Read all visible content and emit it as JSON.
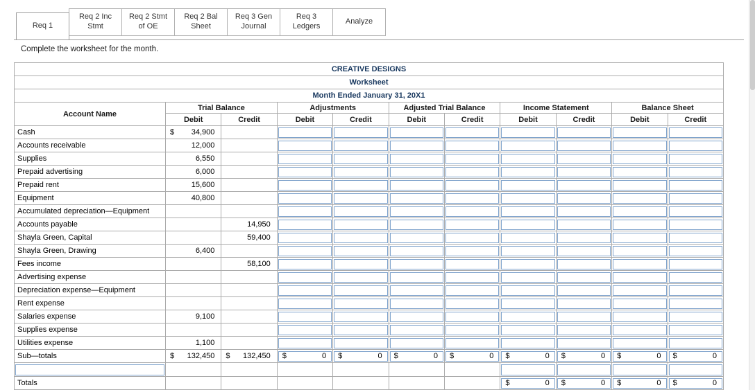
{
  "colors": {
    "title_navy": "#17375e",
    "input_border": "#7fa3cc",
    "grid_border": "#ababab",
    "tab_border": "#b0b0b0"
  },
  "tabs": [
    {
      "label": "Req 1",
      "active": true
    },
    {
      "label": "Req 2 Inc Stmt",
      "active": false
    },
    {
      "label": "Req 2 Stmt of OE",
      "active": false
    },
    {
      "label": "Req 2 Bal Sheet",
      "active": false
    },
    {
      "label": "Req 3 Gen Journal",
      "active": false
    },
    {
      "label": "Req 3 Ledgers",
      "active": false
    },
    {
      "label": "Analyze",
      "active": false
    }
  ],
  "instruction": "Complete the worksheet for the month.",
  "worksheet": {
    "company": "CREATIVE DESIGNS",
    "title": "Worksheet",
    "period": "Month Ended January 31, 20X1",
    "account_header": "Account Name",
    "column_groups": [
      "Trial Balance",
      "Adjustments",
      "Adjusted Trial Balance",
      "Income Statement",
      "Balance Sheet"
    ],
    "sub_headers": [
      "Debit",
      "Credit"
    ],
    "currency": "$",
    "column_keys": [
      "tb_debit",
      "tb_credit",
      "adj_debit",
      "adj_credit",
      "atb_debit",
      "atb_credit",
      "is_debit",
      "is_credit",
      "bs_debit",
      "bs_credit"
    ],
    "body": {
      "account_row_inputs": [
        "adj_debit",
        "adj_credit",
        "atb_debit",
        "atb_credit",
        "is_debit",
        "is_credit",
        "bs_debit",
        "bs_credit"
      ],
      "account_rows": [
        {
          "account": "Cash",
          "values": {
            "tb_debit": "34,900"
          },
          "dollars": [
            "tb_debit"
          ]
        },
        {
          "account": "Accounts receivable",
          "values": {
            "tb_debit": "12,000"
          }
        },
        {
          "account": "Supplies",
          "values": {
            "tb_debit": "6,550"
          }
        },
        {
          "account": "Prepaid advertising",
          "values": {
            "tb_debit": "6,000"
          }
        },
        {
          "account": "Prepaid rent",
          "values": {
            "tb_debit": "15,600"
          }
        },
        {
          "account": "Equipment",
          "values": {
            "tb_debit": "40,800"
          }
        },
        {
          "account": "Accumulated depreciation—Equipment",
          "values": {}
        },
        {
          "account": "Accounts payable",
          "values": {
            "tb_credit": "14,950"
          }
        },
        {
          "account": "Shayla Green, Capital",
          "values": {
            "tb_credit": "59,400"
          }
        },
        {
          "account": "Shayla Green, Drawing",
          "values": {
            "tb_debit": "6,400"
          }
        },
        {
          "account": "Fees income",
          "values": {
            "tb_credit": "58,100"
          }
        },
        {
          "account": "Advertising expense",
          "values": {}
        },
        {
          "account": "Depreciation expense—Equipment",
          "values": {}
        },
        {
          "account": "Rent expense",
          "values": {}
        },
        {
          "account": "Salaries expense",
          "values": {
            "tb_debit": "9,100"
          }
        },
        {
          "account": "Supplies expense",
          "values": {}
        },
        {
          "account": "Utilities expense",
          "values": {
            "tb_debit": "1,100"
          }
        }
      ],
      "subtotals_row": {
        "label": "Sub—totals",
        "values": {
          "tb_debit": "132,450",
          "tb_credit": "132,450",
          "adj_debit": "0",
          "adj_credit": "0",
          "atb_debit": "0",
          "atb_credit": "0",
          "is_debit": "0",
          "is_credit": "0",
          "bs_debit": "0",
          "bs_credit": "0"
        },
        "dollars": [
          "tb_debit",
          "tb_credit",
          "adj_debit",
          "adj_credit",
          "atb_debit",
          "atb_credit",
          "is_debit",
          "is_credit",
          "bs_debit",
          "bs_credit"
        ],
        "inputs": [
          "adj_debit",
          "adj_credit",
          "atb_debit",
          "atb_credit",
          "is_debit",
          "is_credit",
          "bs_debit",
          "bs_credit"
        ]
      },
      "blank_row": {
        "values": {},
        "inputs": [
          "is_debit",
          "is_credit",
          "bs_debit",
          "bs_credit"
        ]
      },
      "totals_row": {
        "label": "Totals",
        "values": {
          "is_debit": "0",
          "is_credit": "0",
          "bs_debit": "0",
          "bs_credit": "0"
        },
        "dollars": [
          "is_debit",
          "is_credit",
          "bs_debit",
          "bs_credit"
        ],
        "inputs": [
          "is_debit",
          "is_credit",
          "bs_debit",
          "bs_credit"
        ]
      }
    }
  }
}
